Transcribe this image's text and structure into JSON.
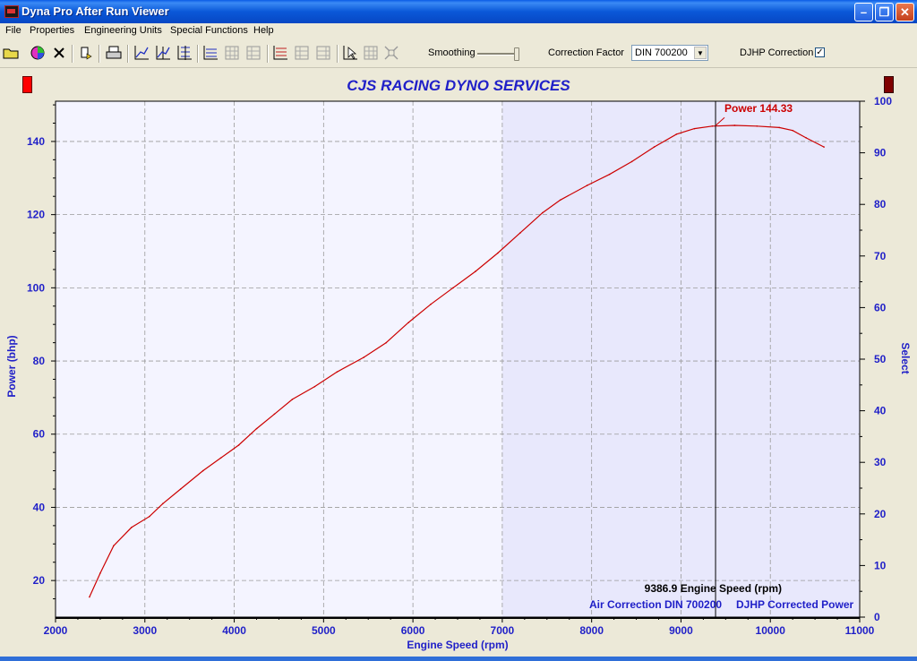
{
  "window": {
    "title": "Dyna Pro After Run Viewer"
  },
  "menu": [
    "File",
    "Properties",
    "Engineering Units",
    "Special Functions",
    "Help"
  ],
  "toolbar": {
    "smoothing_label": "Smoothing",
    "smoothing_level": 0.9,
    "correction_label": "Correction Factor",
    "correction_value": "DIN 700200",
    "djhp_label": "DJHP Correction",
    "djhp_checked": true,
    "checkmark": "✓"
  },
  "colors": {
    "accent": "#1f1fc8",
    "series": "#cc0000",
    "plot_bg": "#f4f4ff",
    "highlight": "#e4e4fb"
  },
  "chart_data": {
    "type": "line",
    "title": "CJS RACING DYNO SERVICES",
    "xlabel": "Engine Speed (rpm)",
    "ylabel": "Power (bhp)",
    "y2label": "Select",
    "xlim": [
      2000,
      11000
    ],
    "ylim": [
      10,
      151
    ],
    "y2lim": [
      0,
      100
    ],
    "xticks": [
      2000,
      3000,
      4000,
      5000,
      6000,
      7000,
      8000,
      9000,
      10000,
      11000
    ],
    "yticks": [
      20,
      40,
      60,
      80,
      100,
      120,
      140
    ],
    "y2ticks": [
      0,
      10,
      20,
      30,
      40,
      50,
      60,
      70,
      80,
      90,
      100
    ],
    "grid": true,
    "series": [
      {
        "name": "DJHP Corrected Power",
        "x": [
          2380,
          2500,
          2650,
          2850,
          3050,
          3200,
          3400,
          3650,
          3850,
          4050,
          4250,
          4450,
          4650,
          4900,
          5150,
          5450,
          5700,
          5950,
          6200,
          6450,
          6700,
          6950,
          7200,
          7450,
          7650,
          7950,
          8200,
          8450,
          8700,
          8950,
          9150,
          9350,
          9600,
          9850,
          10100,
          10250,
          10400,
          10600
        ],
        "y": [
          15.5,
          22,
          29.5,
          34.5,
          37.5,
          41,
          45,
          50,
          53.5,
          57,
          61.5,
          65.5,
          69.5,
          73,
          77,
          81,
          85,
          90.5,
          95.5,
          100,
          104.5,
          109.5,
          115,
          120.5,
          124,
          128,
          131,
          134.5,
          138.5,
          142,
          143.5,
          144.2,
          144.4,
          144.2,
          143.8,
          143,
          141,
          138.5
        ]
      }
    ],
    "cursor": {
      "x": 9386.9,
      "label": "9386.9 Engine Speed (rpm)",
      "readout": "Power 144.33"
    },
    "legend": [
      "Air Correction DIN 700200",
      "DJHP Corrected Power"
    ],
    "legend_position": "bottom-right"
  }
}
